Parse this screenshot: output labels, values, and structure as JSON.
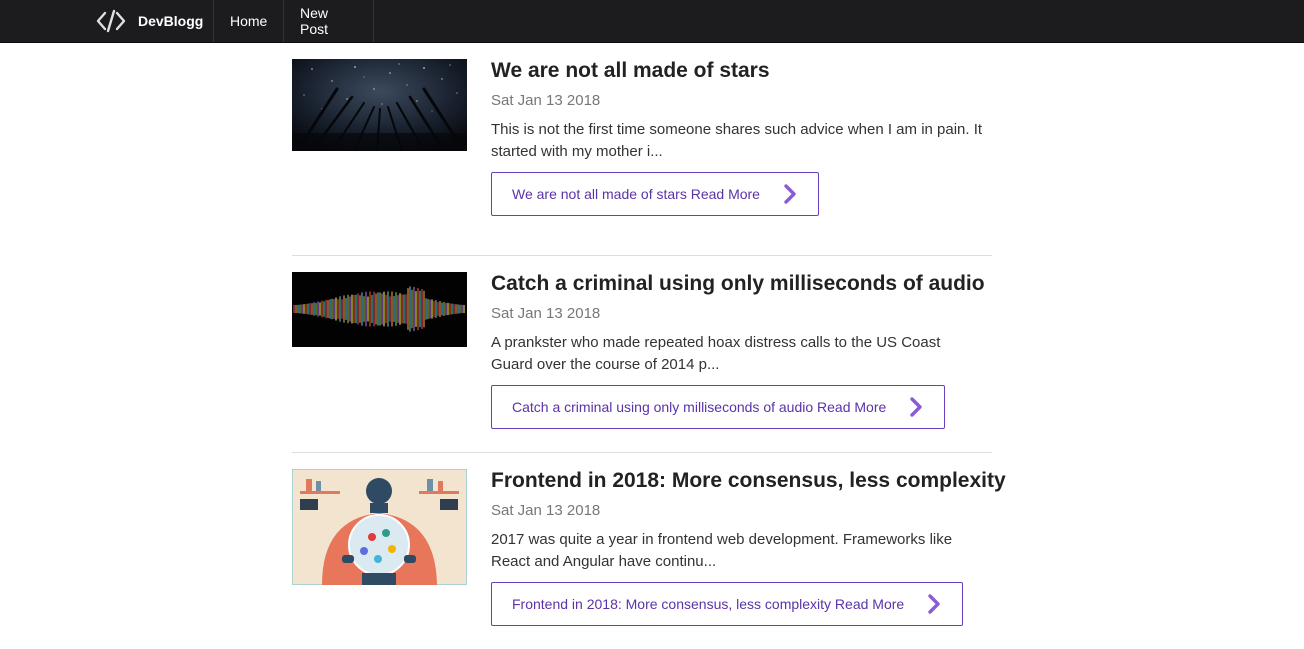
{
  "navbar": {
    "brand_icon": "code-brackets-icon",
    "brand_name": "DevBlogg",
    "links": [
      {
        "label": "Home"
      },
      {
        "label": "New Post"
      }
    ]
  },
  "colors": {
    "navbar_bg": "#1c1c1e",
    "accent": "#6a3fbf",
    "divider": "#dedede"
  },
  "posts": [
    {
      "title": "We are not all made of stars",
      "date": "Sat Jan 13 2018",
      "excerpt": "This is not the first time someone shares such advice when I am in pain. It started with my mother i...",
      "read_more": "We are not all made of stars Read More",
      "image": "night-forest-stars-image"
    },
    {
      "title": "Catch a criminal using only milliseconds of audio",
      "date": "Sat Jan 13 2018",
      "excerpt": "A prankster who made repeated hoax distress calls to the US Coast Guard over the course of 2014 p...",
      "read_more": "Catch a criminal using only milliseconds of audio Read More",
      "image": "audio-waveform-image"
    },
    {
      "title": "Frontend in 2018: More consensus, less complexity",
      "date": "Sat Jan 13 2018",
      "excerpt": "2017 was quite a year in frontend web development. Frameworks like React and Angular have continu...",
      "read_more": "Frontend in 2018: More consensus, less complexity Read More",
      "image": "frontend-crystal-ball-illustration"
    }
  ]
}
